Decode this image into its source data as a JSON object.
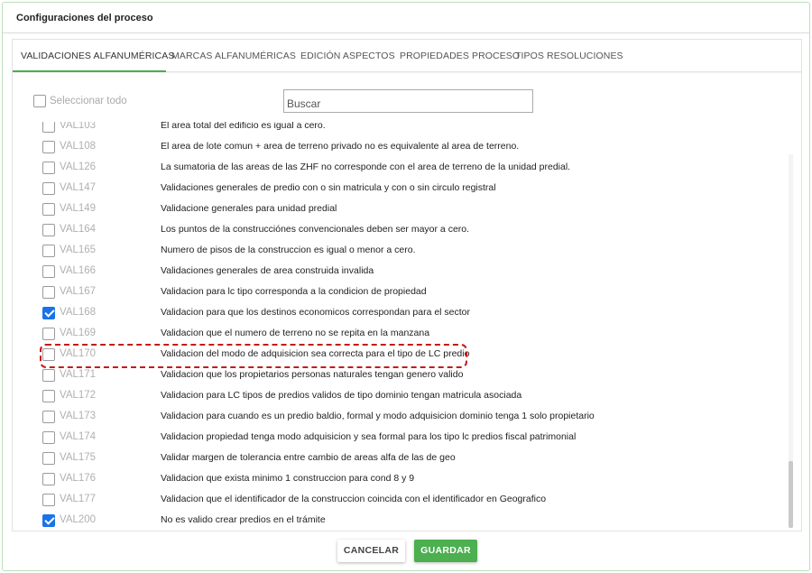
{
  "dialog": {
    "title": "Configuraciones del proceso"
  },
  "tabs": [
    {
      "label": "VALIDACIONES ALFANUMÉRICAS",
      "active": true
    },
    {
      "label": "MARCAS ALFANUMÉRICAS",
      "active": false
    },
    {
      "label": "EDICIÓN ASPECTOS",
      "active": false
    },
    {
      "label": "PROPIEDADES PROCESO",
      "active": false
    },
    {
      "label": "TIPOS RESOLUCIONES",
      "active": false
    }
  ],
  "select_all": {
    "label": "Seleccionar todo",
    "checked": false
  },
  "search": {
    "placeholder": "Buscar",
    "value": ""
  },
  "validations": [
    {
      "code": "VAL103",
      "description": "El area total del edificio es igual a cero.",
      "checked": false
    },
    {
      "code": "VAL108",
      "description": "El area de lote comun + area de terreno privado no es equivalente al area de terreno.",
      "checked": false
    },
    {
      "code": "VAL126",
      "description": "La sumatoria de las areas de las ZHF no corresponde con el area de terreno de la unidad predial.",
      "checked": false
    },
    {
      "code": "VAL147",
      "description": "Validaciones generales de predio con o sin matricula y con o sin circulo registral",
      "checked": false
    },
    {
      "code": "VAL149",
      "description": "Validacione generales para unidad predial",
      "checked": false
    },
    {
      "code": "VAL164",
      "description": "Los puntos de la construcciónes convencionales deben ser mayor a cero.",
      "checked": false
    },
    {
      "code": "VAL165",
      "description": "Numero de pisos de la construccion es igual o menor a cero.",
      "checked": false
    },
    {
      "code": "VAL166",
      "description": "Validaciones generales de area construida invalida",
      "checked": false
    },
    {
      "code": "VAL167",
      "description": "Validacion para lc tipo corresponda a la condicion de propiedad",
      "checked": false
    },
    {
      "code": "VAL168",
      "description": "Validacion para que los destinos economicos correspondan para el sector",
      "checked": true
    },
    {
      "code": "VAL169",
      "description": "Validacion que el numero de terreno no se repita en la manzana",
      "checked": false
    },
    {
      "code": "VAL170",
      "description": "Validacion del modo de adquisicion sea correcta para el tipo de LC predio",
      "checked": false
    },
    {
      "code": "VAL171",
      "description": "Validacion que los propietarios personas naturales tengan genero valido",
      "checked": false
    },
    {
      "code": "VAL172",
      "description": "Validacion para LC tipos de predios validos de tipo dominio tengan matricula asociada",
      "checked": false
    },
    {
      "code": "VAL173",
      "description": "Validacion para cuando es un predio baldio, formal y modo adquisicion dominio tenga 1 solo propietario",
      "checked": false
    },
    {
      "code": "VAL174",
      "description": "Validacion propiedad tenga modo adquisicion y sea formal para los tipo lc predios fiscal patrimonial",
      "checked": false
    },
    {
      "code": "VAL175",
      "description": "Validar margen de tolerancia entre cambio de areas alfa de las de geo",
      "checked": false
    },
    {
      "code": "VAL176",
      "description": "Validacion que exista minimo 1 construccion para cond 8 y 9",
      "checked": false
    },
    {
      "code": "VAL177",
      "description": "Validacion que el identificador de la construccion coincida con el identificador en Geografico",
      "checked": false
    },
    {
      "code": "VAL200",
      "description": "No es valido crear predios en el trámite",
      "checked": true
    }
  ],
  "footer": {
    "cancel_label": "CANCELAR",
    "save_label": "GUARDAR"
  },
  "colors": {
    "accent_green": "#4caf50",
    "checkbox_blue": "#1a73e8",
    "highlight_red": "#c41a1a"
  }
}
